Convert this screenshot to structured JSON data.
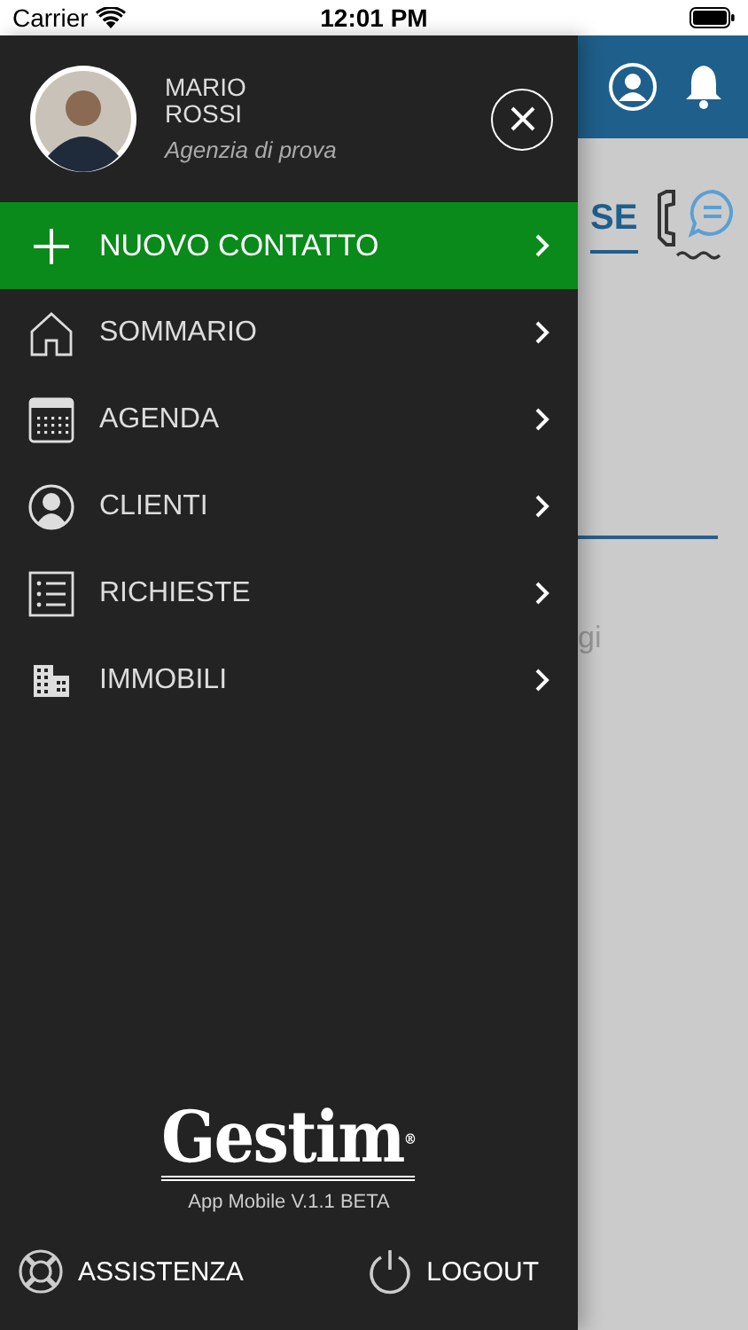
{
  "status_bar": {
    "carrier": "Carrier",
    "time": "12:01 PM"
  },
  "background": {
    "tab": "SE",
    "hint": "gi"
  },
  "drawer": {
    "user": {
      "name_line_1": "MARIO",
      "name_line_2": "ROSSI",
      "agency": "Agenzia di prova"
    },
    "menu": [
      {
        "label": "NUOVO CONTATTO",
        "kind": "primary"
      },
      {
        "label": "SOMMARIO",
        "kind": "normal"
      },
      {
        "label": "AGENDA",
        "kind": "normal"
      },
      {
        "label": "CLIENTI",
        "kind": "normal"
      },
      {
        "label": "RICHIESTE",
        "kind": "normal"
      },
      {
        "label": "IMMOBILI",
        "kind": "normal"
      }
    ],
    "logo": "Gestim",
    "logo_mark": "®",
    "version": "App Mobile V.1.1 BETA",
    "footer": [
      {
        "label": "ASSISTENZA"
      },
      {
        "label": "LOGOUT"
      }
    ]
  }
}
